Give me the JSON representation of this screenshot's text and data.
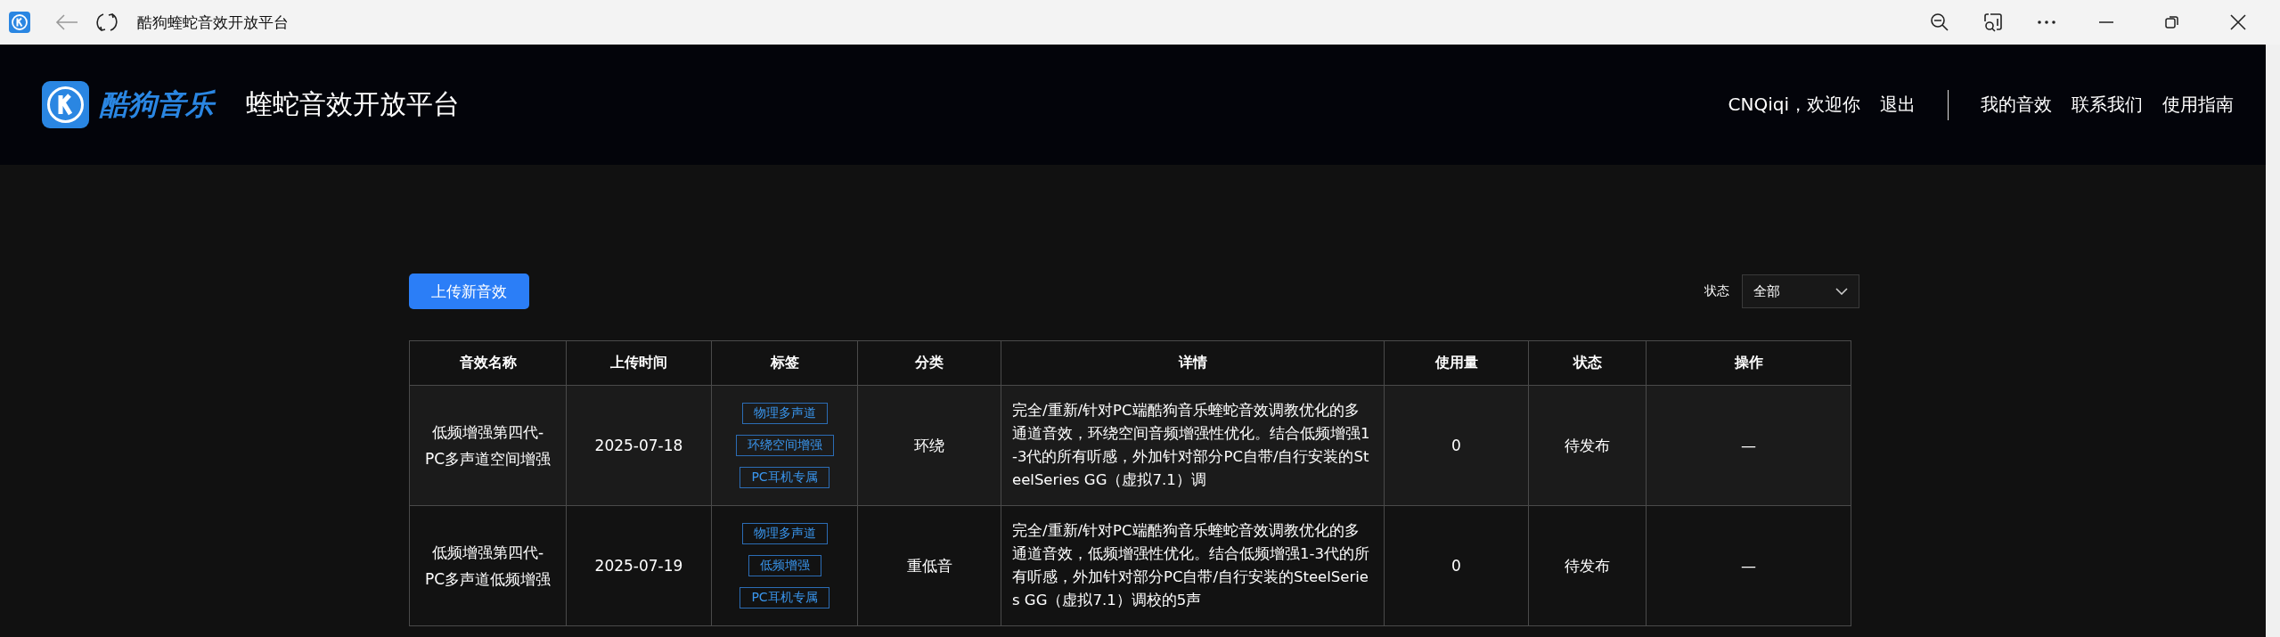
{
  "browser": {
    "title": "酷狗蝰蛇音效开放平台"
  },
  "header": {
    "logo_text": "酷狗音乐",
    "site_title": "蝰蛇音效开放平台",
    "greeting": "CNQiqi，欢迎你",
    "logout": "退出",
    "nav": [
      "我的音效",
      "联系我们",
      "使用指南"
    ]
  },
  "toolbar": {
    "upload_button": "上传新音效",
    "filter_label": "状态",
    "filter_value": "全部"
  },
  "table": {
    "columns": [
      "音效名称",
      "上传时间",
      "标签",
      "分类",
      "详情",
      "使用量",
      "状态",
      "操作"
    ],
    "rows": [
      {
        "name": "低频增强第四代-PC多声道空间增强",
        "date": "2025-07-18",
        "tags": [
          "物理多声道",
          "环绕空间增强",
          "PC耳机专属"
        ],
        "category": "环绕",
        "detail": "完全/重新/针对PC端酷狗音乐蝰蛇音效调教优化的多通道音效，环绕空间音频增强性优化。结合低频增强1-3代的所有听感，外加针对部分PC自带/自行安装的SteelSeries GG（虚拟7.1）调",
        "usage": "0",
        "status": "待发布",
        "action": "—"
      },
      {
        "name": "低频增强第四代-PC多声道低频增强",
        "date": "2025-07-19",
        "tags": [
          "物理多声道",
          "低频增强",
          "PC耳机专属"
        ],
        "category": "重低音",
        "detail": "完全/重新/针对PC端酷狗音乐蝰蛇音效调教优化的多通道音效，低频增强性优化。结合低频增强1-3代的所有听感，外加针对部分PC自带/自行安装的SteelSeries GG（虚拟7.1）调校的5声",
        "usage": "0",
        "status": "待发布",
        "action": "—"
      }
    ]
  }
}
